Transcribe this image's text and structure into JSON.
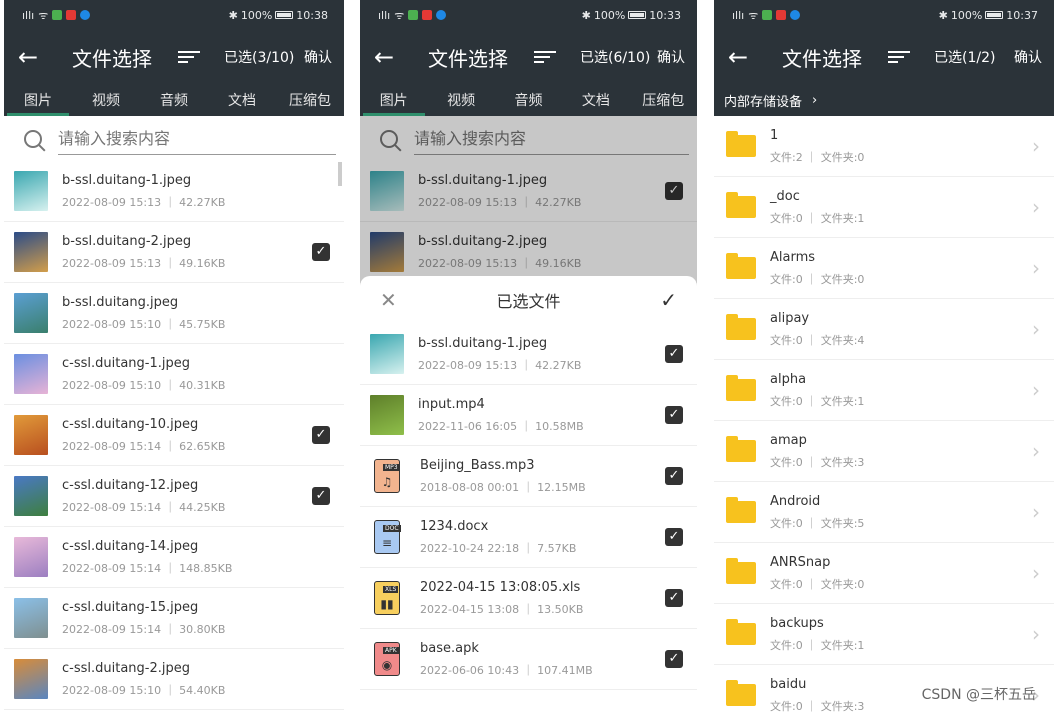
{
  "status": {
    "left_icons": [
      "signal",
      "wifi",
      "usb",
      "app-icons"
    ],
    "battery": "100%"
  },
  "screens": [
    {
      "time": "10:38",
      "title": "文件选择",
      "selected": "已选(3/10)",
      "confirm": "确认",
      "tabs": [
        "图片",
        "视频",
        "音频",
        "文档",
        "压缩包"
      ],
      "search_placeholder": "请输入搜索内容",
      "files": [
        {
          "name": "b-ssl.duitang-1.jpeg",
          "meta": "2022-08-09 15:13 ｜ 42.27KB",
          "checked": false,
          "c1": "#3aa7b0",
          "c2": "#d7f1ef"
        },
        {
          "name": "b-ssl.duitang-2.jpeg",
          "meta": "2022-08-09 15:13 ｜ 49.16KB",
          "checked": true,
          "c1": "#2b4c88",
          "c2": "#d39e4a"
        },
        {
          "name": "b-ssl.duitang.jpeg",
          "meta": "2022-08-09 15:10 ｜ 45.75KB",
          "checked": false,
          "c1": "#5b9fd3",
          "c2": "#3a7f6c"
        },
        {
          "name": "c-ssl.duitang-1.jpeg",
          "meta": "2022-08-09 15:10 ｜ 40.31KB",
          "checked": false,
          "c1": "#6b8fe0",
          "c2": "#e7b3d6"
        },
        {
          "name": "c-ssl.duitang-10.jpeg",
          "meta": "2022-08-09 15:14 ｜ 62.65KB",
          "checked": true,
          "c1": "#e19a3a",
          "c2": "#b84f1f"
        },
        {
          "name": "c-ssl.duitang-12.jpeg",
          "meta": "2022-08-09 15:14 ｜ 44.25KB",
          "checked": true,
          "c1": "#4a79c5",
          "c2": "#3e7f3e"
        },
        {
          "name": "c-ssl.duitang-14.jpeg",
          "meta": "2022-08-09 15:14 ｜ 148.85KB",
          "checked": false,
          "c1": "#e8b9d9",
          "c2": "#9c7fc1"
        },
        {
          "name": "c-ssl.duitang-15.jpeg",
          "meta": "2022-08-09 15:14 ｜ 30.80KB",
          "checked": false,
          "c1": "#8bc0e8",
          "c2": "#7f8f8f"
        },
        {
          "name": "c-ssl.duitang-2.jpeg",
          "meta": "2022-08-09 15:10 ｜ 54.40KB",
          "checked": false,
          "c1": "#d88c3a",
          "c2": "#5a86c0"
        }
      ]
    },
    {
      "time": "10:33",
      "title": "文件选择",
      "selected": "已选(6/10)",
      "confirm": "确认",
      "tabs": [
        "图片",
        "视频",
        "音频",
        "文档",
        "压缩包"
      ],
      "search_placeholder": "请输入搜索内容",
      "files": [
        {
          "name": "b-ssl.duitang-1.jpeg",
          "meta": "2022-08-09 15:13 ｜ 42.27KB",
          "checked": true,
          "c1": "#3aa7b0",
          "c2": "#d7f1ef"
        },
        {
          "name": "b-ssl.duitang-2.jpeg",
          "meta": "2022-08-09 15:13 ｜ 49.16KB",
          "checked": false,
          "c1": "#2b4c88",
          "c2": "#d39e4a"
        }
      ],
      "sheet_title": "已选文件",
      "sheet_files": [
        {
          "name": "b-ssl.duitang-1.jpeg",
          "meta": "2022-08-09 15:13 ｜ 42.27KB",
          "kind": "image",
          "c1": "#3aa7b0",
          "c2": "#d7f1ef"
        },
        {
          "name": "input.mp4",
          "meta": "2022-11-06 16:05 ｜ 10.58MB",
          "kind": "image",
          "c1": "#5e7f2a",
          "c2": "#8fbf4a"
        },
        {
          "name": "Beijing_Bass.mp3",
          "meta": "2018-08-08 00:01 ｜ 12.15MB",
          "kind": "mp3",
          "tag": "MP3",
          "color": "#f2b48f"
        },
        {
          "name": "1234.docx",
          "meta": "2022-10-24 22:18 ｜ 7.57KB",
          "kind": "doc",
          "tag": "DOC",
          "color": "#a9c9f2"
        },
        {
          "name": "2022-04-15 13:08:05.xls",
          "meta": "2022-04-15 13:08 ｜ 13.50KB",
          "kind": "xls",
          "tag": "XLS",
          "color": "#f7cf5e"
        },
        {
          "name": "base.apk",
          "meta": "2022-06-06 10:43 ｜ 107.41MB",
          "kind": "apk",
          "tag": "APK",
          "color": "#f08a8a"
        }
      ]
    },
    {
      "time": "10:37",
      "title": "文件选择",
      "selected": "已选(1/2)",
      "confirm": "确认",
      "breadcrumb": "内部存储设备",
      "folders": [
        {
          "name": "1",
          "meta": "文件:2 ｜ 文件夹:0"
        },
        {
          "name": "_doc",
          "meta": "文件:0 ｜ 文件夹:1"
        },
        {
          "name": "Alarms",
          "meta": "文件:0 ｜ 文件夹:0"
        },
        {
          "name": "alipay",
          "meta": "文件:0 ｜ 文件夹:4"
        },
        {
          "name": "alpha",
          "meta": "文件:0 ｜ 文件夹:1"
        },
        {
          "name": "amap",
          "meta": "文件:0 ｜ 文件夹:3"
        },
        {
          "name": "Android",
          "meta": "文件:0 ｜ 文件夹:5"
        },
        {
          "name": "ANRSnap",
          "meta": "文件:0 ｜ 文件夹:0"
        },
        {
          "name": "backups",
          "meta": "文件:0 ｜ 文件夹:1"
        },
        {
          "name": "baidu",
          "meta": "文件:0 ｜ 文件夹:3"
        }
      ]
    }
  ],
  "watermark": "CSDN @三杯五岳"
}
